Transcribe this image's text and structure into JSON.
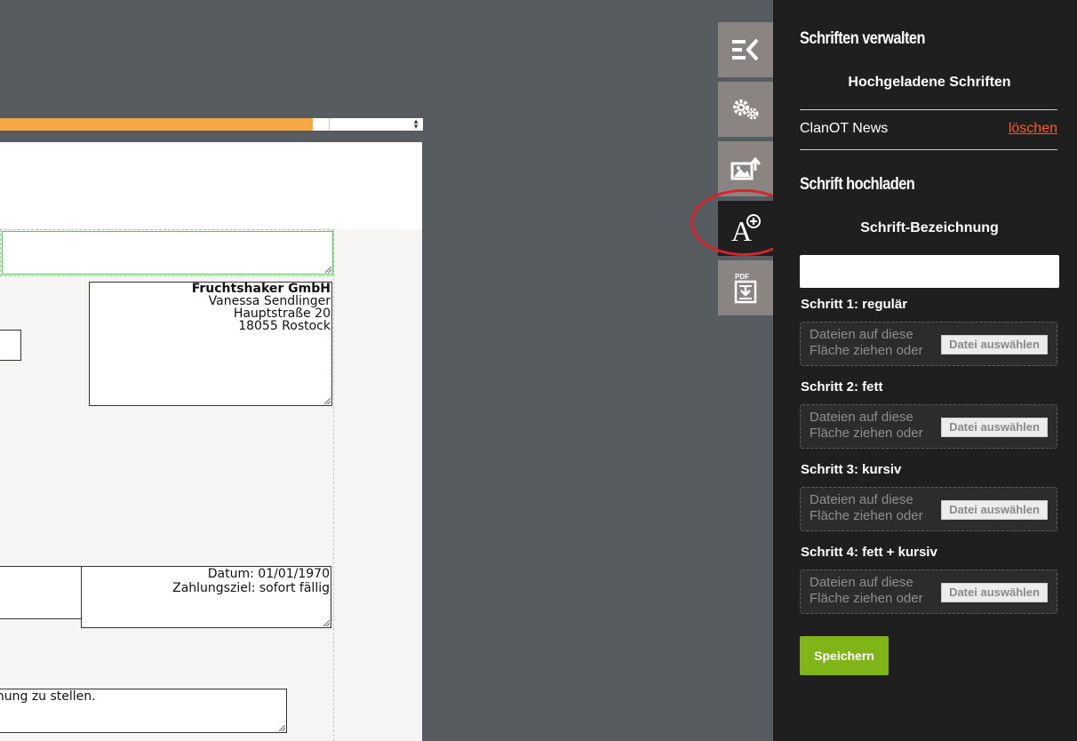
{
  "document": {
    "zoom_progress_percent": 74,
    "address_lines": [
      "Fruchtshaker GmbH",
      "Vanessa Sendlinger",
      "Hauptstraße 20",
      "18055 Rostock"
    ],
    "date_line": "Datum: 01/01/1970",
    "due_line": "Zahlungsziel: sofort fällig",
    "text_fragment": "nnung zu stellen."
  },
  "rail": {
    "items": [
      {
        "icon": "collapse-panel-icon"
      },
      {
        "icon": "settings-gears-icon"
      },
      {
        "icon": "image-upload-icon"
      },
      {
        "icon": "add-font-icon",
        "active": true
      },
      {
        "icon": "pdf-download-icon",
        "label": "PDF"
      }
    ]
  },
  "panel": {
    "title": "Schriften verwalten",
    "uploaded_heading": "Hochgeladene Schriften",
    "uploaded_fonts": [
      {
        "name": "ClanOT News",
        "delete_label": "löschen"
      }
    ],
    "upload_title": "Schrift hochladen",
    "font_name_label": "Schrift-Bezeichnung",
    "font_name_value": "",
    "steps": [
      {
        "label": "Schritt 1: regulär"
      },
      {
        "label": "Schritt 2: fett"
      },
      {
        "label": "Schritt 3: kursiv"
      },
      {
        "label": "Schritt 4: fett + kursiv"
      }
    ],
    "dropzone_text": "Dateien auf diese Fläche ziehen oder",
    "file_button_label": "Datei auswählen",
    "save_label": "Speichern"
  },
  "colors": {
    "accent_orange": "#f5a944",
    "delete_link": "#ff5a1f",
    "save_green": "#7fb519",
    "highlight_ring": "#d8232a"
  }
}
